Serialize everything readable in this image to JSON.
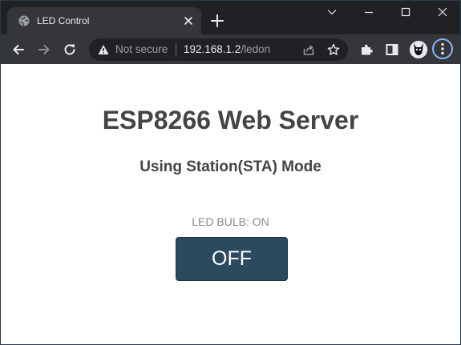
{
  "browser": {
    "tab": {
      "title": "LED Control",
      "favicon": "globe-icon"
    },
    "window_controls": [
      "chevron-down-icon",
      "minimize-icon",
      "maximize-icon",
      "close-icon"
    ],
    "omnibox": {
      "security_label": "Not secure",
      "url_host": "192.168.1.2",
      "url_path": "/ledon"
    },
    "toolbar_icons": [
      "back-arrow-icon",
      "forward-arrow-icon",
      "reload-icon",
      "extensions-puzzle-icon",
      "side-panel-icon",
      "profile-avatar",
      "kebab-menu-icon"
    ],
    "colors": {
      "tabstrip_bg": "#202124",
      "toolbar_bg": "#35363a",
      "focus_ring": "#8ab4f8"
    }
  },
  "page": {
    "title": "ESP8266 Web Server",
    "subtitle": "Using Station(STA) Mode",
    "led_status": "LED BULB: ON",
    "toggle_button_label": "OFF",
    "colors": {
      "text": "#444444",
      "status_text": "#888888",
      "button_bg": "#2c4a5e",
      "button_text": "#ffffff"
    }
  }
}
